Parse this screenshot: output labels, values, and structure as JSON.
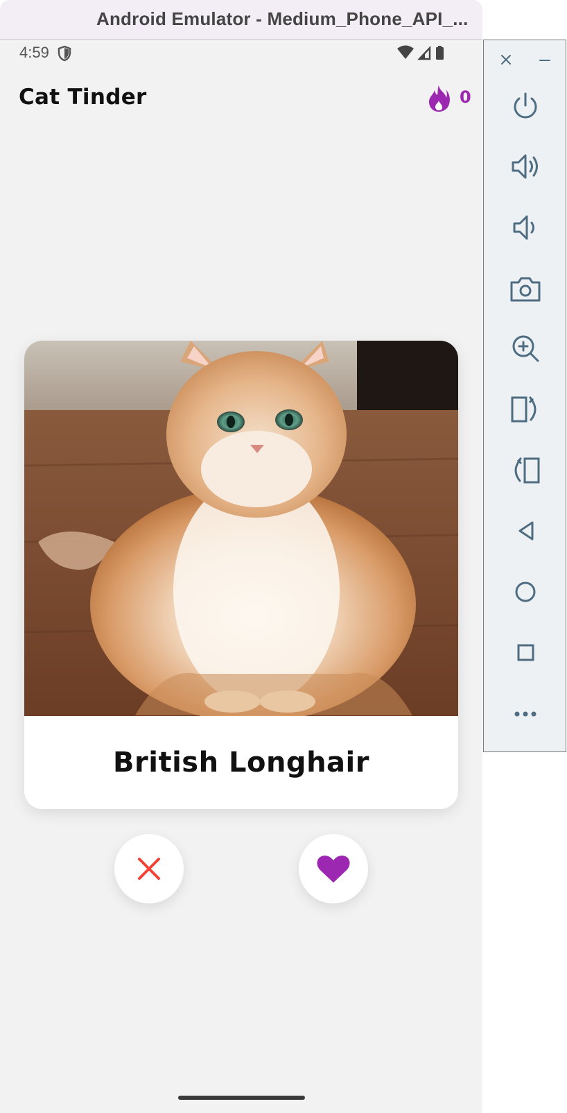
{
  "window": {
    "title": "Android Emulator - Medium_Phone_API_..."
  },
  "status_bar": {
    "time": "4:59",
    "icons": [
      "shield-icon",
      "wifi-icon",
      "cellular-signal-icon",
      "battery-icon"
    ]
  },
  "app": {
    "title": "Cat Tinder",
    "streak": {
      "icon": "flame-icon",
      "count": "0"
    }
  },
  "card": {
    "image_subject": "fluffy ginger and white longhair cat sitting on a wooden floor",
    "breed_name": "British Longhair"
  },
  "actions": [
    {
      "id": "dislike",
      "icon": "close-icon"
    },
    {
      "id": "like",
      "icon": "heart-icon"
    }
  ],
  "emulator_toolbar": {
    "window_controls": [
      "close-icon",
      "minimize-icon"
    ],
    "buttons": [
      "power-icon",
      "volume-up-icon",
      "volume-down-icon",
      "camera-icon",
      "zoom-in-icon",
      "rotate-left-icon",
      "rotate-right-icon",
      "back-icon",
      "home-icon",
      "overview-icon",
      "more-icon"
    ]
  },
  "colors": {
    "accent": "#9c27b0",
    "dislike": "#f44336",
    "background": "#f2f2f2",
    "card": "#ffffff",
    "toolbar_icon": "#4e6d82"
  }
}
